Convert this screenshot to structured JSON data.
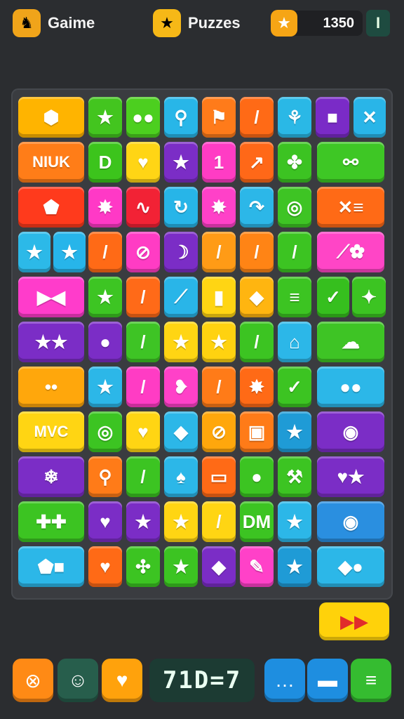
{
  "header": {
    "game_label": "Gaime",
    "puzzles_label": "Puzzes",
    "score": "1350",
    "menu_label": "I"
  },
  "board": {
    "tiles": [
      {
        "label": "⬢",
        "color": "#ffb400",
        "icon": "shield-icon"
      },
      {
        "label": "★",
        "color": "#43c51f",
        "icon": "star-icon"
      },
      {
        "label": "●●",
        "color": "#4ccf1f",
        "icon": "eyes-icon"
      },
      {
        "label": "⚲",
        "color": "#28b6e8",
        "icon": "wrench-icon"
      },
      {
        "label": "⚑",
        "color": "#ff7b1a",
        "icon": "flag-icon"
      },
      {
        "label": "/",
        "color": "#ff6a16",
        "icon": "stick-icon"
      },
      {
        "label": "⚘",
        "color": "#2ab8e6",
        "icon": "figure-icon"
      },
      {
        "label": "■",
        "color": "#7a2bc7",
        "icon": "square-icon"
      },
      {
        "label": "✕",
        "color": "#29b5e8",
        "icon": "cross-icon"
      },
      {
        "label": "NIUK",
        "color": "#ff7d18",
        "icon": "text-tile"
      },
      {
        "label": "D",
        "color": "#3cc41c",
        "icon": "letter-d-icon"
      },
      {
        "label": "♥",
        "color": "#ffd515",
        "icon": "heart-icon"
      },
      {
        "label": "★",
        "color": "#7b2dc6",
        "icon": "star-icon"
      },
      {
        "label": "1",
        "color": "#ff3cc4",
        "icon": "number-one-icon"
      },
      {
        "label": "↗",
        "color": "#ff6818",
        "icon": "leaf-icon"
      },
      {
        "label": "✤",
        "color": "#3cc322",
        "icon": "clover-icon"
      },
      {
        "label": "⚯",
        "color": "#3ec725",
        "icon": "link-icon"
      },
      {
        "label": "⬟",
        "color": "#ff3a1c",
        "icon": "badge-icon"
      },
      {
        "label": "✸",
        "color": "#ff39c6",
        "icon": "splat-icon"
      },
      {
        "label": "∿",
        "color": "#f22235",
        "icon": "squiggle-icon"
      },
      {
        "label": "↻",
        "color": "#27b5e8",
        "icon": "refresh-icon"
      },
      {
        "label": "✸",
        "color": "#ff41c8",
        "icon": "splat-icon"
      },
      {
        "label": "↷",
        "color": "#2cb7e8",
        "icon": "curve-arrow-icon"
      },
      {
        "label": "◎",
        "color": "#3ec424",
        "icon": "ring-icon"
      },
      {
        "label": "✕≡",
        "color": "#ff6a16",
        "icon": "cross-lines-icon"
      },
      {
        "label": "★",
        "color": "#2cb9e8",
        "icon": "star-icon"
      },
      {
        "label": "★",
        "color": "#27b5ea",
        "icon": "star-icon"
      },
      {
        "label": "/",
        "color": "#ff6a16",
        "icon": "stick-icon"
      },
      {
        "label": "⊘",
        "color": "#ff3cc4",
        "icon": "pin-icon"
      },
      {
        "label": "☽",
        "color": "#7b2dc6",
        "icon": "moon-icon"
      },
      {
        "label": "/",
        "color": "#ff9b16",
        "icon": "stick-icon"
      },
      {
        "label": "/",
        "color": "#ff8415",
        "icon": "stick-icon"
      },
      {
        "label": "/",
        "color": "#3cc422",
        "icon": "stick-icon"
      },
      {
        "label": "⟋✿",
        "color": "#ff45c6",
        "icon": "wand-icon"
      },
      {
        "label": "▶◀",
        "color": "#ff3ccb",
        "icon": "arrows-icon"
      },
      {
        "label": "★",
        "color": "#3dc523",
        "icon": "star-icon"
      },
      {
        "label": "/",
        "color": "#ff6a18",
        "icon": "stick-icon"
      },
      {
        "label": "⟋",
        "color": "#29b5e8",
        "icon": "feather-icon"
      },
      {
        "label": "▮",
        "color": "#ffd513",
        "icon": "bar-icon"
      },
      {
        "label": "◆",
        "color": "#ffb510",
        "icon": "gem-icon"
      },
      {
        "label": "≡",
        "color": "#3cc422",
        "icon": "list-icon"
      },
      {
        "label": "✓",
        "color": "#36bf1e",
        "icon": "check-icon"
      },
      {
        "label": "✦",
        "color": "#3cc422",
        "icon": "pin-icon"
      },
      {
        "label": "★★",
        "color": "#7b2dc6",
        "icon": "stars-icon"
      },
      {
        "label": "●",
        "color": "#7b2dc6",
        "icon": "blob-icon"
      },
      {
        "label": "/",
        "color": "#3ec425",
        "icon": "stick-icon"
      },
      {
        "label": "★",
        "color": "#ffd513",
        "icon": "star-icon"
      },
      {
        "label": "★",
        "color": "#ffd210",
        "icon": "star-icon"
      },
      {
        "label": "/",
        "color": "#3cc422",
        "icon": "stick-icon"
      },
      {
        "label": "⌂",
        "color": "#2cb7e8",
        "icon": "house-icon"
      },
      {
        "label": "☁",
        "color": "#3ec425",
        "icon": "bubble-icon"
      },
      {
        "label": "••",
        "color": "#ffa70c",
        "icon": "bubble-icon"
      },
      {
        "label": "★",
        "color": "#2cb7e8",
        "icon": "star-icon"
      },
      {
        "label": "/",
        "color": "#ff3cc4",
        "icon": "stick-icon"
      },
      {
        "label": "❥",
        "color": "#ff41c8",
        "icon": "leaf-icon"
      },
      {
        "label": "/",
        "color": "#ff7b18",
        "icon": "stick-icon"
      },
      {
        "label": "✸",
        "color": "#ff6a16",
        "icon": "splat-icon"
      },
      {
        "label": "✓",
        "color": "#3cc422",
        "icon": "check-icon"
      },
      {
        "label": "●●",
        "color": "#2cb7e8",
        "icon": "face-icon"
      },
      {
        "label": "MVC",
        "color": "#ffd513",
        "icon": "text-tile"
      },
      {
        "label": "◎",
        "color": "#3cc422",
        "icon": "ring-icon"
      },
      {
        "label": "♥",
        "color": "#ffd513",
        "icon": "heart-icon"
      },
      {
        "label": "◆",
        "color": "#2cb7e8",
        "icon": "gem-icon"
      },
      {
        "label": "⊘",
        "color": "#ffa70c",
        "icon": "pin-icon"
      },
      {
        "label": "▣",
        "color": "#ff7b18",
        "icon": "box-icon"
      },
      {
        "label": "★",
        "color": "#1f9bd6",
        "icon": "star-icon"
      },
      {
        "label": "◉",
        "color": "#7b2dc6",
        "icon": "orb-icon"
      },
      {
        "label": "❄",
        "color": "#7b2dc6",
        "icon": "snowflake-icon"
      },
      {
        "label": "⚲",
        "color": "#ff7b18",
        "icon": "key-icon"
      },
      {
        "label": "/",
        "color": "#3cc422",
        "icon": "stick-icon"
      },
      {
        "label": "♠",
        "color": "#2cb7e8",
        "icon": "leaf-icon"
      },
      {
        "label": "▭",
        "color": "#ff6a16",
        "icon": "bandage-icon"
      },
      {
        "label": "●",
        "color": "#3cc422",
        "icon": "dot-icon"
      },
      {
        "label": "⚒",
        "color": "#3cc422",
        "icon": "hammer-icon"
      },
      {
        "label": "♥★",
        "color": "#7b2dc6",
        "icon": "heart-star-icon"
      },
      {
        "label": "✚✚",
        "color": "#3cc422",
        "icon": "cross-icon"
      },
      {
        "label": "♥",
        "color": "#7b2dc6",
        "icon": "heart-icon"
      },
      {
        "label": "★",
        "color": "#7b2dc6",
        "icon": "star-icon"
      },
      {
        "label": "★",
        "color": "#ffd513",
        "icon": "star-icon"
      },
      {
        "label": "/",
        "color": "#ffd513",
        "icon": "stick-icon"
      },
      {
        "label": "DM",
        "color": "#3cc422",
        "icon": "text-tile"
      },
      {
        "label": "★",
        "color": "#2cb7e8",
        "icon": "star-icon"
      },
      {
        "label": "◉",
        "color": "#2a8fe0",
        "icon": "orb-icon"
      },
      {
        "label": "⬟■",
        "color": "#2cb7e8",
        "icon": "shapes-icon"
      },
      {
        "label": "♥",
        "color": "#ff6a16",
        "icon": "heart-icon"
      },
      {
        "label": "✣",
        "color": "#3cc422",
        "icon": "dots-icon"
      },
      {
        "label": "★",
        "color": "#3cc422",
        "icon": "star-icon"
      },
      {
        "label": "◆",
        "color": "#7b2dc6",
        "icon": "gem-icon"
      },
      {
        "label": "✎",
        "color": "#ff41c8",
        "icon": "pencil-icon"
      },
      {
        "label": "★",
        "color": "#1f9bd6",
        "icon": "star-icon"
      },
      {
        "label": "◆●",
        "color": "#2cb7e8",
        "icon": "gem-coin-icon"
      }
    ]
  },
  "side_button": {
    "label": "▶▶"
  },
  "bottom": {
    "counter": "71D=7",
    "buttons": [
      {
        "label": "⊗",
        "color": "#ff8a15",
        "icon": "no-icon"
      },
      {
        "label": "☺",
        "color": "#275e4c",
        "icon": "face-icon"
      },
      {
        "label": "♥",
        "color": "#ffa20c",
        "icon": "heart-icon"
      },
      {
        "label": "…",
        "color": "#1e8ee0",
        "icon": "chat-icon"
      },
      {
        "label": "▬",
        "color": "#1e8ee0",
        "icon": "card-icon"
      },
      {
        "label": "≡",
        "color": "#35bc30",
        "icon": "note-icon"
      }
    ]
  }
}
